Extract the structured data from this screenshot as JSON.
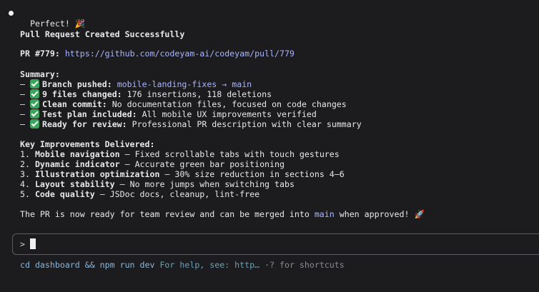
{
  "status": {
    "label": "Perfect!",
    "emoji": "🎉"
  },
  "heading": "Pull Request Created Successfully",
  "pr": {
    "label": "PR #779:",
    "url": "https://github.com/codeyam-ai/codeyam/pull/779"
  },
  "summary": {
    "title": "Summary:",
    "items": [
      {
        "prefix": "– ",
        "bold": "Branch pushed:",
        "code": "mobile-landing-fixes → main",
        "text": ""
      },
      {
        "prefix": "– ",
        "bold": "9 files changed:",
        "code": "",
        "text": "176 insertions, 118 deletions"
      },
      {
        "prefix": "– ",
        "bold": "Clean commit:",
        "code": "",
        "text": "No documentation files, focused on code changes"
      },
      {
        "prefix": "– ",
        "bold": "Test plan included:",
        "code": "",
        "text": "All mobile UX improvements verified"
      },
      {
        "prefix": "– ",
        "bold": "Ready for review:",
        "code": "",
        "text": "Professional PR description with clear summary"
      }
    ]
  },
  "improvements": {
    "title": "Key Improvements Delivered:",
    "items": [
      {
        "num": "1.",
        "bold": "Mobile navigation",
        "text": "– Fixed scrollable tabs with touch gestures"
      },
      {
        "num": "2.",
        "bold": "Dynamic indicator",
        "text": "– Accurate green bar positioning"
      },
      {
        "num": "3.",
        "bold": "Illustration optimization",
        "text": "– 30% size reduction in sections 4–6"
      },
      {
        "num": "4.",
        "bold": "Layout stability",
        "text": "– No more jumps when switching tabs"
      },
      {
        "num": "5.",
        "bold": "Code quality",
        "text": "– JSDoc docs, cleanup, lint-free"
      }
    ]
  },
  "closing": {
    "before": "The PR is now ready for team review and can be merged into ",
    "code": "main",
    "after": " when approved!",
    "emoji": "🚀"
  },
  "input": {
    "prompt": ">",
    "value": ""
  },
  "footer": {
    "command": "cd dashboard && npm run dev",
    "help": "For help, see: http…",
    "shortcuts": "·? for shortcuts"
  },
  "colors": {
    "background": "#1c1c1e",
    "accent_code": "#aab4ff",
    "check": "#3aa55a"
  }
}
